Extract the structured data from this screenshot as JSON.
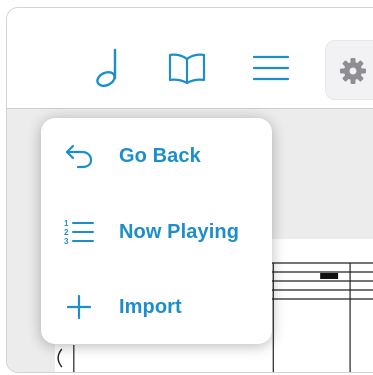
{
  "toolbar": {
    "buttons": [
      {
        "name": "note-icon",
        "label": ""
      },
      {
        "name": "book-icon",
        "label": ""
      },
      {
        "name": "menu-lines-icon",
        "label": ""
      },
      {
        "name": "gear-icon",
        "label": ""
      }
    ]
  },
  "menu": {
    "items": [
      {
        "icon": "back-arrow-icon",
        "label": "Go Back"
      },
      {
        "icon": "numbered-list-icon",
        "label": "Now Playing"
      },
      {
        "icon": "plus-icon",
        "label": "Import"
      }
    ]
  },
  "colors": {
    "accent": "#1c8fca",
    "toolbar_background": "#ffffff",
    "score_background": "#ececec",
    "popover_background": "#ffffff",
    "gear_color": "#8e8e93"
  }
}
